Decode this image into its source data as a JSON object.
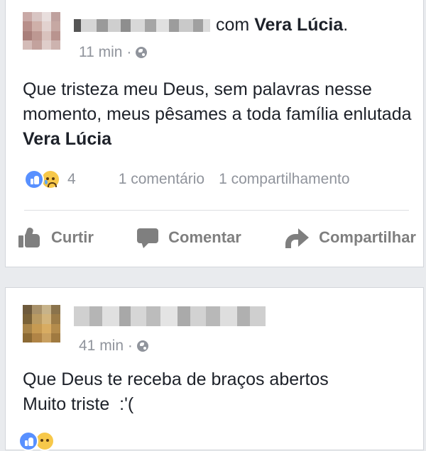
{
  "post1": {
    "author_blurred": true,
    "with_prefix": "com",
    "tagged_name": "Vera Lúcia",
    "tagged_suffix": ".",
    "time": "11 min",
    "separator": "·",
    "privacy_icon": "globe-icon",
    "text_main": "Que tristeza meu Deus, sem palavras nesse momento, meus pêsames a toda família enlutada ",
    "text_bold": "Vera Lúcia",
    "reaction_icons": [
      "like-icon",
      "sad-face-icon"
    ],
    "reaction_count": "4",
    "comments": "1 comentário",
    "shares": "1 compartilhamento",
    "actions": {
      "like": "Curtir",
      "comment": "Comentar",
      "share": "Compartilhar"
    }
  },
  "post2": {
    "author_blurred": true,
    "time": "41 min",
    "separator": "·",
    "privacy_icon": "globe-icon",
    "text_line1": "Que Deus te receba de braços abertos",
    "text_line2": "Muito triste  :'("
  },
  "colors": {
    "page_bg": "#e9ebee",
    "card_bg": "#ffffff",
    "text": "#1d2129",
    "muted": "#90949c",
    "like_blue": "#5890ff",
    "sad_yellow": "#f7c84a",
    "action_gray": "#7f7f7f"
  }
}
